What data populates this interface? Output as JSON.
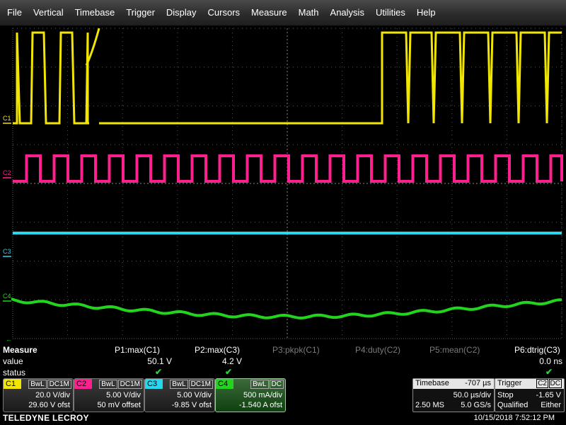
{
  "menu": [
    "File",
    "Vertical",
    "Timebase",
    "Trigger",
    "Display",
    "Cursors",
    "Measure",
    "Math",
    "Analysis",
    "Utilities",
    "Help"
  ],
  "channel_markers": [
    "C1",
    "C2",
    "C3",
    "C4"
  ],
  "colors": {
    "c1": "#f2e600",
    "c2": "#ff1f8e",
    "c3": "#27d7f0",
    "c4": "#22d41e",
    "grid": "#5a5a5a",
    "menu_bg": "#2a2a2a"
  },
  "measure": {
    "title": "Measure",
    "row_value": "value",
    "row_status": "status",
    "params": [
      {
        "label": "P1:max(C1)",
        "value": "50.1 V",
        "active": true
      },
      {
        "label": "P2:max(C3)",
        "value": "4.2 V",
        "active": true
      },
      {
        "label": "P3:pkpk(C1)",
        "value": "",
        "active": false
      },
      {
        "label": "P4:duty(C2)",
        "value": "",
        "active": false
      },
      {
        "label": "P5:mean(C2)",
        "value": "",
        "active": false
      },
      {
        "label": "P6:dtrig(C3)",
        "value": "0.0 ns",
        "active": true
      }
    ]
  },
  "channels": [
    {
      "id": "C1",
      "flag1": "BwL",
      "flag2": "DC1M",
      "vdiv": "20.0 V/div",
      "offset": "29.60 V ofst",
      "color": "#f2e600"
    },
    {
      "id": "C2",
      "flag1": "BwL",
      "flag2": "DC1M",
      "vdiv": "5.00 V/div",
      "offset": "50 mV offset",
      "color": "#ff1f8e"
    },
    {
      "id": "C3",
      "flag1": "BwL",
      "flag2": "DC1M",
      "vdiv": "5.00 V/div",
      "offset": "-9.85 V ofst",
      "color": "#27d7f0"
    },
    {
      "id": "C4",
      "flag1": "BwL",
      "flag2": "DC",
      "vdiv": "500 mA/div",
      "offset": "-1.540 A ofst",
      "color": "#22d41e"
    }
  ],
  "timebase": {
    "label": "Timebase",
    "delay": "-707 µs",
    "tdiv": "50.0 µs/div",
    "samples": "2.50 MS",
    "rate": "5.0 GS/s"
  },
  "trigger": {
    "label": "Trigger",
    "source": "C2",
    "coupling": "DC",
    "mode": "Stop",
    "level": "-1.65 V",
    "type": "Qualified",
    "slope": "Either"
  },
  "brand": "TELEDYNE LECROY",
  "datetime": "10/15/2018 7:52:12 PM"
}
